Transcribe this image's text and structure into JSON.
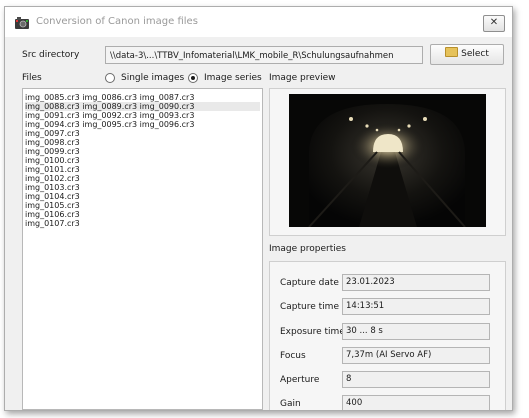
{
  "window": {
    "title": "Conversion of Canon image files",
    "close_symbol": "✕"
  },
  "src": {
    "label": "Src directory",
    "path": "\\\\data-3\\...\\TTBV_Infomaterial\\LMK_mobile_R\\Schulungsaufnahmen",
    "select_label": "Select"
  },
  "files": {
    "label": "Files",
    "mode_single": "Single images",
    "mode_series": "Image series",
    "selected_mode": "Image series",
    "rows": [
      "img_0085.cr3 img_0086.cr3 img_0087.cr3",
      "img_0088.cr3 img_0089.cr3 img_0090.cr3",
      "img_0091.cr3 img_0092.cr3 img_0093.cr3",
      "img_0094.cr3 img_0095.cr3 img_0096.cr3",
      "img_0097.cr3",
      "img_0098.cr3",
      "img_0099.cr3",
      "img_0100.cr3",
      "img_0101.cr3",
      "img_0102.cr3",
      "img_0103.cr3",
      "img_0104.cr3",
      "img_0105.cr3",
      "img_0106.cr3",
      "img_0107.cr3"
    ],
    "selected_row": 1
  },
  "preview": {
    "label": "Image preview",
    "image": "dark tunnel with ceiling lights"
  },
  "properties": {
    "label": "Image properties",
    "capture_date_label": "Capture date",
    "capture_date": "23.01.2023",
    "capture_time_label": "Capture time",
    "capture_time": "14:13:51",
    "exposure_time_label": "Exposure time",
    "exposure_time": "30 ... 8 s",
    "focus_label": "Focus",
    "focus": "7,37m (AI Servo AF)",
    "aperture_label": "Aperture",
    "aperture": "8",
    "gain_label": "Gain",
    "gain": "400"
  },
  "colors": {
    "window_bg": "#f0f0f0",
    "title_text": "#9a9a9a",
    "selection": "#e9e9e9"
  }
}
